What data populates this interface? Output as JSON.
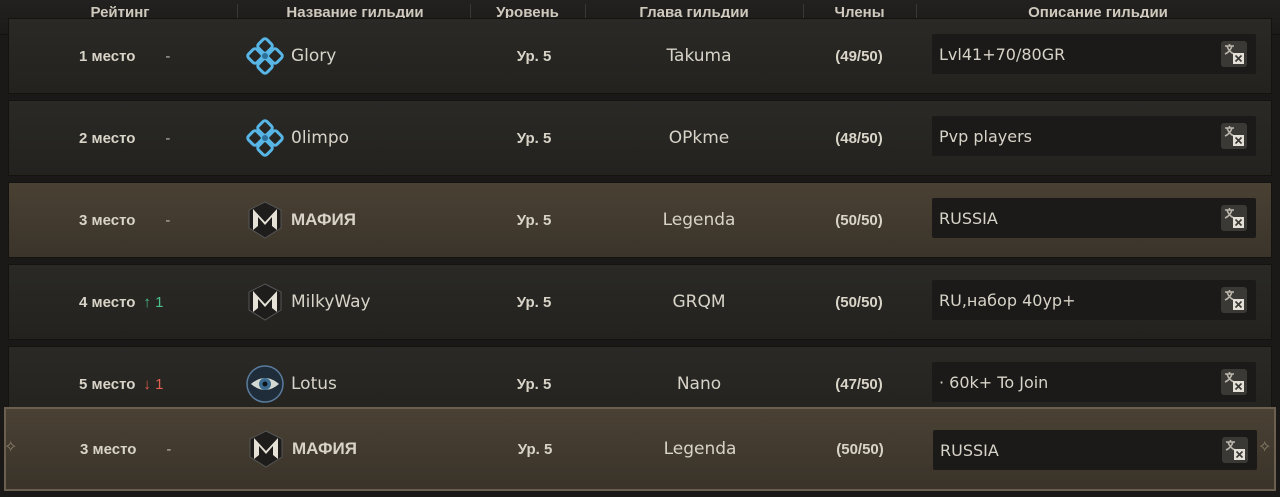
{
  "header": {
    "rank": "Рейтинг",
    "name": "Название гильдии",
    "level": "Уровень",
    "leader": "Глава гильдии",
    "members": "Члены",
    "description": "Описание гильдии"
  },
  "rows": [
    {
      "rank": "1 место",
      "change": "-",
      "trend": "none",
      "guild": "Glory",
      "emblem": "blue-knot-emblem-icon",
      "level": "Ур. 5",
      "leader": "Takuma",
      "members": "(49/50)",
      "description": "Lvl41+70/80GR"
    },
    {
      "rank": "2 место",
      "change": "-",
      "trend": "none",
      "guild": "0limpo",
      "emblem": "blue-knot-emblem-icon",
      "level": "Ур. 5",
      "leader": "OPkme",
      "members": "(48/50)",
      "description": "Pvp players"
    },
    {
      "rank": "3 место",
      "change": "-",
      "trend": "none",
      "guild": "МАФИЯ",
      "emblem": "m-shield-emblem-icon",
      "level": "Ур. 5",
      "leader": "Legenda",
      "members": "(50/50)",
      "description": "RUSSIA"
    },
    {
      "rank": "4 место",
      "change": "↑ 1",
      "trend": "up",
      "guild": "MilkyWay",
      "emblem": "m-shield-emblem-icon",
      "level": "Ур. 5",
      "leader": "GRQM",
      "members": "(50/50)",
      "description": "RU,набор 40ур+"
    },
    {
      "rank": "5 место",
      "change": "↓ 1",
      "trend": "down",
      "guild": "Lotus",
      "emblem": "eye-emblem-icon",
      "level": "Ур. 5",
      "leader": "Nano",
      "members": "(47/50)",
      "description": "· 60k+ To Join"
    }
  ],
  "own_row": {
    "rank": "3 место",
    "change": "-",
    "guild": "МАФИЯ",
    "emblem": "m-shield-emblem-icon",
    "level": "Ур. 5",
    "leader": "Legenda",
    "members": "(50/50)",
    "description": "RUSSIA"
  },
  "colors": {
    "up": "#4bc08a",
    "down": "#e0604e",
    "highlight": "#4a4134",
    "row": "#2a2926"
  },
  "icons": {
    "translate": "translate-icon"
  }
}
